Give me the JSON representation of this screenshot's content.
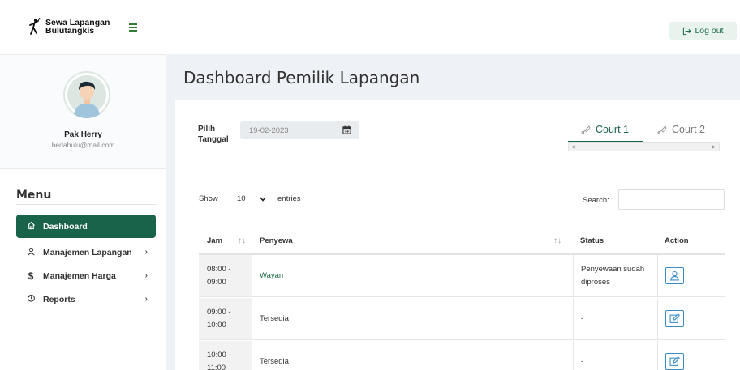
{
  "sidebar": {
    "brand_line1": "Sewa Lapangan",
    "brand_line2": "Bulutangkis",
    "user_name": "Pak Herry",
    "user_email": "bedahulu@mail.com",
    "menu_title": "Menu",
    "items": [
      {
        "label": "Dashboard",
        "icon": "home-icon",
        "active": true
      },
      {
        "label": "Manajemen Lapangan",
        "icon": "user-icon",
        "active": false
      },
      {
        "label": "Manajemen Harga",
        "icon": "dollar-icon",
        "active": false
      },
      {
        "label": "Reports",
        "icon": "history-icon",
        "active": false
      }
    ]
  },
  "header": {
    "logout_label": "Log out"
  },
  "main": {
    "page_title": "Dashboard Pemilik Lapangan",
    "date_label": "Pilih Tanggal",
    "date_value": "19-02-2023",
    "tabs": [
      {
        "label": "Court 1",
        "active": true
      },
      {
        "label": "Court 2",
        "active": false
      }
    ],
    "show_label": "Show",
    "entries_count": "10",
    "entries_label": "entries",
    "search_label": "Search:",
    "search_value": ""
  },
  "table": {
    "headers": {
      "jam": "Jam",
      "penyewa": "Penyewa",
      "status": "Status",
      "action": "Action"
    },
    "rows": [
      {
        "jam": "08:00 - 09:00",
        "penyewa": "Wayan",
        "status": "Penyewaan sudah diproses",
        "action_icon": "user-icon"
      },
      {
        "jam": "09:00 - 10:00",
        "penyewa": "Tersedia",
        "status": "-",
        "action_icon": "edit-icon"
      },
      {
        "jam": "10:00 - 11:00",
        "penyewa": "Tersedia",
        "status": "-",
        "action_icon": "edit-icon"
      }
    ]
  },
  "colors": {
    "accent": "#19634b",
    "link": "#1f6b48",
    "action_border": "#3a8cc7"
  }
}
